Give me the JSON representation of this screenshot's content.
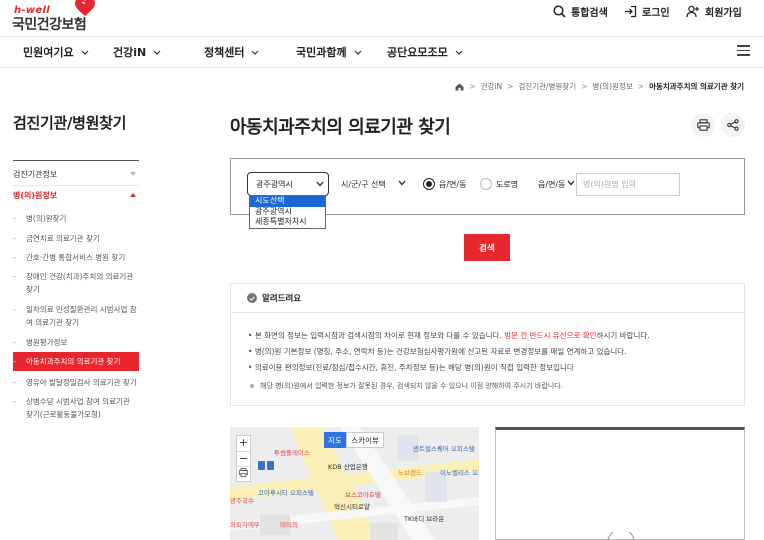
{
  "header": {
    "logo_sub": "h-well",
    "logo_main": "국민건강보험",
    "utils": {
      "search": "통합검색",
      "login": "로그인",
      "join": "회원가입"
    }
  },
  "gnb": [
    "민원여기요",
    "건강iN",
    "정책센터",
    "국민과함께",
    "공단요모조모"
  ],
  "breadcrumb": [
    "건강iN",
    "검진기관/병원찾기",
    "병(의)원정보",
    "아동치과주치의 의료기관 찾기"
  ],
  "sidebar": {
    "title": "검진기관/병원찾기",
    "sec1": "검진기관정보",
    "sec2": "병(의)원정보",
    "items": [
      "병(의)원찾기",
      "금연치료 의료기관 찾기",
      "간호·간병 통합서비스 병원 찾기",
      "장애인 건강(치과)주치의 의료기관 찾기",
      "일차의료 만성질환관리 시범사업 참여 의료기관 찾기",
      "병원평가정보",
      "아동치과주치의 의료기관 찾기",
      "영유아 발달정밀검사 의료기관 찾기",
      "상병수당 시범사업 참여 의료기관 찾기(근로활동불가모형)"
    ]
  },
  "main": {
    "title": "아동치과주치의 의료기관 찾기",
    "search": {
      "region_value": "광주광역시",
      "region_options": [
        "시도선택",
        "광주광역시",
        "세종특별자치시"
      ],
      "district_value": "시/군/구 선택",
      "radio1": "읍/면/동",
      "radio2": "도로명",
      "type_value": "읍/면/동",
      "name_placeholder": "병(의)원명 입력",
      "button": "검색"
    },
    "notice": {
      "title": "알려드려요",
      "line1_a": "본 화면의 정보는 입력시점과 검색시점의 차이로 현재 정보와 다를 수 있습니다. ",
      "line1_red": "방문 전 반드시 유선으로 확인",
      "line1_b": "하시기 바랍니다.",
      "line2": "병(의)원 기본정보 (명칭, 주소, 연락처 등)는 건강보험심사평가원에 신고된 자료로 변경정보를 매일 연계하고 있습니다.",
      "line3": "의료이용 편의정보(진료/점심/접수시간, 휴진, 주차정보 등)는 해당 병(의)원이 직접 입력한 정보입니다",
      "note": "해당 병(의)원에서 입력한 정보가 잘못된 경우, 검색되지 않을 수 있으니 이점 양해하여 주시기 바랍니다."
    }
  },
  "map": {
    "tab_map": "지도",
    "tab_sky": "스카이뷰",
    "zoom_in": "+",
    "zoom_out": "−",
    "labels": [
      "센트럴스퀘어 오피스텔",
      "KDB 산업은행",
      "노브랜드",
      "이노벨리스 오피스텔",
      "투썸플레이스",
      "코아루시티 오피스텔",
      "보스코아호텔",
      "혁신시티로얄",
      "광주국수",
      "TK바디 브라운",
      "와피자에뚜",
      "미미의"
    ]
  },
  "colors": {
    "accent": "#e8262d",
    "dropdown_highlight": "#1a68d5"
  }
}
